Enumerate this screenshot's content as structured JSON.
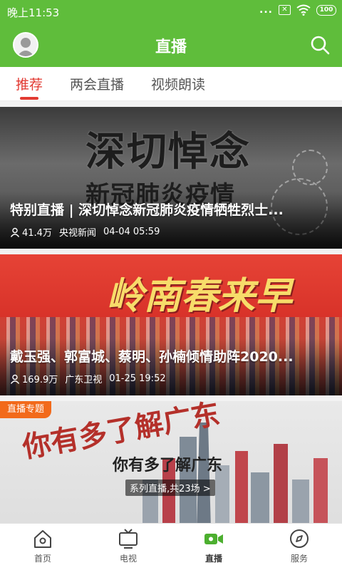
{
  "status_bar": {
    "time": "晚上11:53",
    "dots": "...",
    "battery": "100"
  },
  "header": {
    "title": "直播",
    "brand_color": "#5fbd3b"
  },
  "tabs": [
    {
      "label": "推荐",
      "active": true
    },
    {
      "label": "两会直播",
      "active": false
    },
    {
      "label": "视频朗读",
      "active": false
    }
  ],
  "accent_color": "#e23a32",
  "cards": [
    {
      "artwork_line1": "深切悼念",
      "artwork_line2": "新冠肺炎疫情",
      "title": "特别直播 | 深切悼念新冠肺炎疫情牺牲烈士...",
      "views": "41.4万",
      "source": "央视新闻",
      "time": "04-04 05:59"
    },
    {
      "artwork_line1": "岭南春来早",
      "title": "戴玉强、郭富城、蔡明、孙楠倾情助阵2020...",
      "views": "169.9万",
      "source": "广东卫视",
      "time": "01-25 19:52"
    },
    {
      "badge": "直播专题",
      "artwork": "你有多了解广东",
      "title": "你有多了解广东",
      "subtitle": "系列直播,共23场 >"
    }
  ],
  "bottom_nav": [
    {
      "label": "首页",
      "icon": "home-icon",
      "active": false
    },
    {
      "label": "电视",
      "icon": "tv-icon",
      "active": false
    },
    {
      "label": "直播",
      "icon": "live-camera-icon",
      "active": true
    },
    {
      "label": "服务",
      "icon": "compass-icon",
      "active": false
    }
  ]
}
